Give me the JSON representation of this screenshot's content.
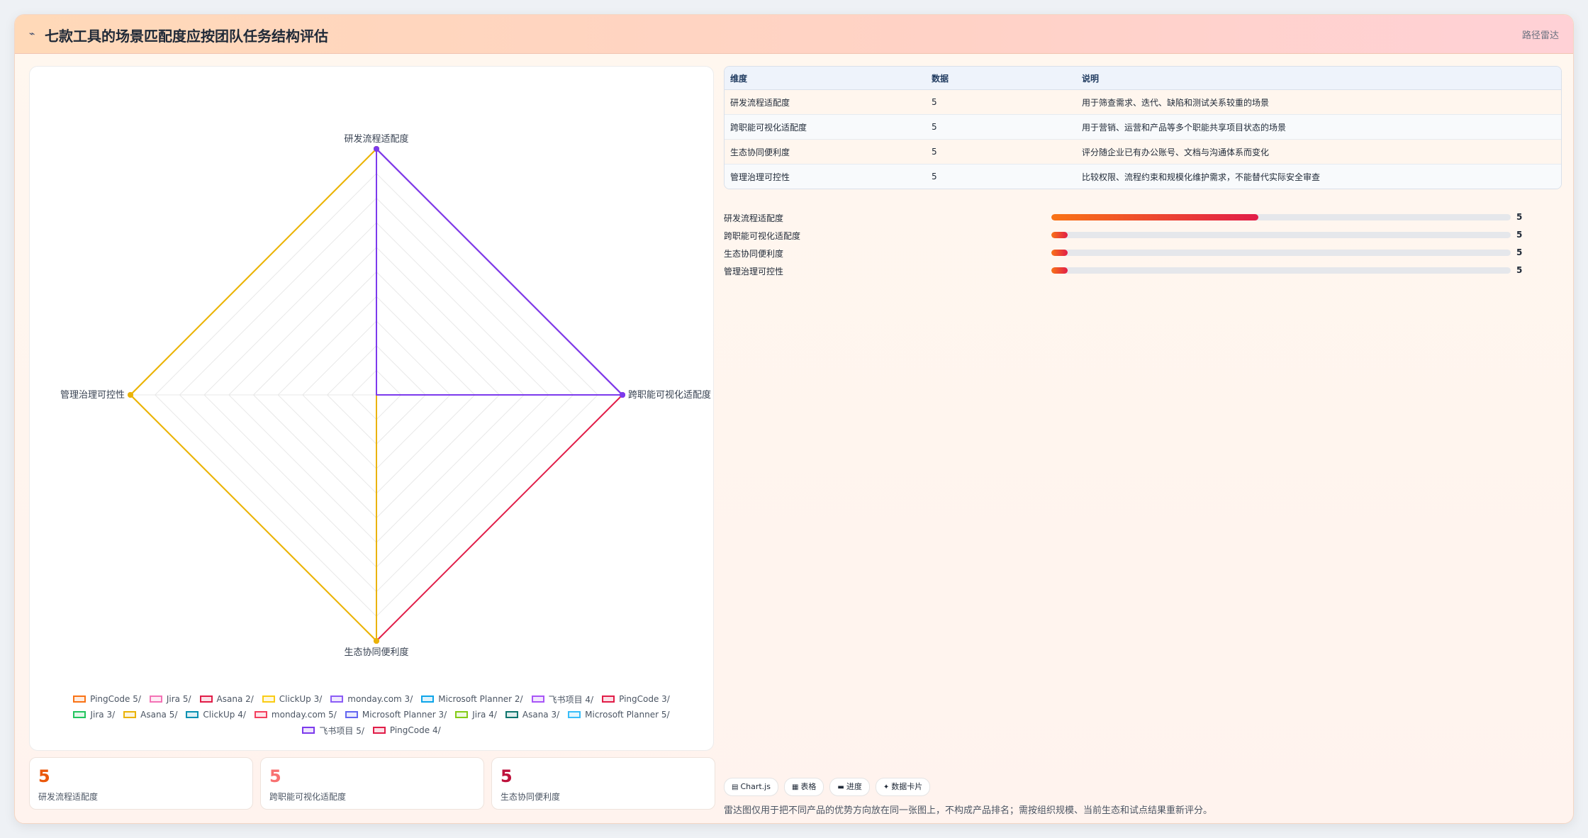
{
  "header": {
    "title": "七款工具的场景匹配度应按团队任务结构评估",
    "link": "路径雷达"
  },
  "chart_data": {
    "type": "radar",
    "axes": [
      "研发流程适配度",
      "跨职能可视化适配度",
      "生态协同便利度",
      "管理治理可控性"
    ],
    "range": [
      0,
      5
    ],
    "series": [
      {
        "name": "PingCode 5/",
        "values": [
          5,
          5,
          0,
          0
        ],
        "color": "#f97316"
      },
      {
        "name": "Jira 5/",
        "values": [
          0,
          5,
          0,
          0
        ],
        "color": "#f472b6"
      },
      {
        "name": "Asana 2/",
        "values": [
          0,
          5,
          5,
          0
        ],
        "color": "#e11d48"
      },
      {
        "name": "ClickUp 3/",
        "values": [
          5,
          0,
          5,
          5
        ],
        "color": "#facc15"
      },
      {
        "name": "monday.com 3/",
        "values": [
          5,
          5,
          0,
          0
        ],
        "color": "#8b5cf6"
      },
      {
        "name": "Microsoft Planner 2/",
        "values": [
          0,
          0,
          0,
          0
        ],
        "color": "#0ea5e9"
      },
      {
        "name": "飞书项目 4/",
        "values": [
          5,
          5,
          0,
          0
        ],
        "color": "#a855f7"
      },
      {
        "name": "PingCode 3/",
        "values": [
          0,
          0,
          0,
          0
        ],
        "color": "#e11d48"
      },
      {
        "name": "Jira 3/",
        "values": [
          0,
          0,
          0,
          0
        ],
        "color": "#22c55e"
      },
      {
        "name": "Asana 5/",
        "values": [
          5,
          0,
          5,
          5
        ],
        "color": "#eab308"
      },
      {
        "name": "ClickUp 4/",
        "values": [
          0,
          0,
          0,
          0
        ],
        "color": "#0891b2"
      },
      {
        "name": "monday.com 5/",
        "values": [
          0,
          0,
          0,
          0
        ],
        "color": "#f43f5e"
      },
      {
        "name": "Microsoft Planner 3/",
        "values": [
          0,
          0,
          0,
          0
        ],
        "color": "#6366f1"
      },
      {
        "name": "Jira 4/",
        "values": [
          0,
          0,
          0,
          0
        ],
        "color": "#84cc16"
      },
      {
        "name": "Asana 3/",
        "values": [
          0,
          0,
          0,
          0
        ],
        "color": "#0f766e"
      },
      {
        "name": "Microsoft Planner 5/",
        "values": [
          0,
          0,
          0,
          0
        ],
        "color": "#38bdf8"
      },
      {
        "name": "飞书项目 5/",
        "values": [
          5,
          5,
          0,
          0
        ],
        "color": "#7c3aed"
      },
      {
        "name": "PingCode 4/",
        "values": [
          0,
          0,
          0,
          0
        ],
        "color": "#e11d48"
      }
    ]
  },
  "stats": [
    {
      "value": "5",
      "label": "研发流程适配度",
      "color": "#ea580c"
    },
    {
      "value": "5",
      "label": "跨职能可视化适配度",
      "color": "#f87171"
    },
    {
      "value": "5",
      "label": "生态协同便利度",
      "color": "#be123c"
    }
  ],
  "table": {
    "headers": [
      "维度",
      "数据",
      "说明"
    ],
    "rows": [
      [
        "研发流程适配度",
        "5",
        "用于筛查需求、迭代、缺陷和测试关系较重的场景"
      ],
      [
        "跨职能可视化适配度",
        "5",
        "用于营销、运营和产品等多个职能共享项目状态的场景"
      ],
      [
        "生态协同便利度",
        "5",
        "评分随企业已有办公账号、文档与沟通体系而变化"
      ],
      [
        "管理治理可控性",
        "5",
        "比较权限、流程约束和规模化维护需求，不能替代实际安全审查"
      ]
    ]
  },
  "progress": [
    {
      "label": "研发流程适配度",
      "value": "5",
      "fraction": 0.45
    },
    {
      "label": "跨职能可视化适配度",
      "value": "5",
      "fraction": 0.035
    },
    {
      "label": "生态协同便利度",
      "value": "5",
      "fraction": 0.035
    },
    {
      "label": "管理治理可控性",
      "value": "5",
      "fraction": 0.035
    }
  ],
  "chips": [
    {
      "icon": "▤",
      "label": "Chart.js"
    },
    {
      "icon": "▦",
      "label": "表格"
    },
    {
      "icon": "▬",
      "label": "进度"
    },
    {
      "icon": "✦",
      "label": "数据卡片"
    }
  ],
  "note": "雷达图仅用于把不同产品的优势方向放在同一张图上，不构成产品排名；需按组织规模、当前生态和试点结果重新评分。",
  "colors": {
    "accent": "#f97316",
    "accent2": "#e11d48"
  }
}
